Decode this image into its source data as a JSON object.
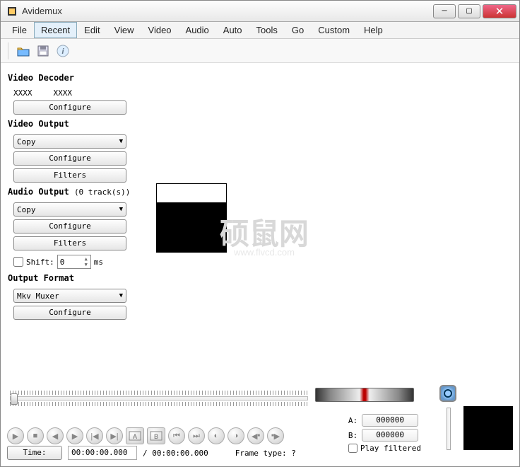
{
  "window": {
    "title": "Avidemux"
  },
  "menu": [
    "File",
    "Recent",
    "Edit",
    "View",
    "Video",
    "Audio",
    "Auto",
    "Tools",
    "Go",
    "Custom",
    "Help"
  ],
  "menu_active_index": 1,
  "decoder": {
    "title": "Video Decoder",
    "fourcc1": "XXXX",
    "fourcc2": "XXXX",
    "configure": "Configure"
  },
  "video_out": {
    "title": "Video Output",
    "codec": "Copy",
    "configure": "Configure",
    "filters": "Filters"
  },
  "audio_out": {
    "title": "Audio Output",
    "tracks": "(0 track(s))",
    "codec": "Copy",
    "configure": "Configure",
    "filters": "Filters",
    "shift_label": "Shift:",
    "shift_value": "0",
    "shift_unit": "ms"
  },
  "output_fmt": {
    "title": "Output Format",
    "muxer": "Mkv Muxer",
    "configure": "Configure"
  },
  "marks": {
    "a_label": "A:",
    "a_value": "000000",
    "b_label": "B:",
    "b_value": "000000",
    "play_filtered": "Play filtered"
  },
  "time": {
    "label": "Time:",
    "current": "00:00:00.000",
    "total": "/ 00:00:00.000",
    "frame_type": "Frame type: ?"
  },
  "watermark": {
    "text": "硕鼠网",
    "sub": "www.flvcd.com"
  }
}
